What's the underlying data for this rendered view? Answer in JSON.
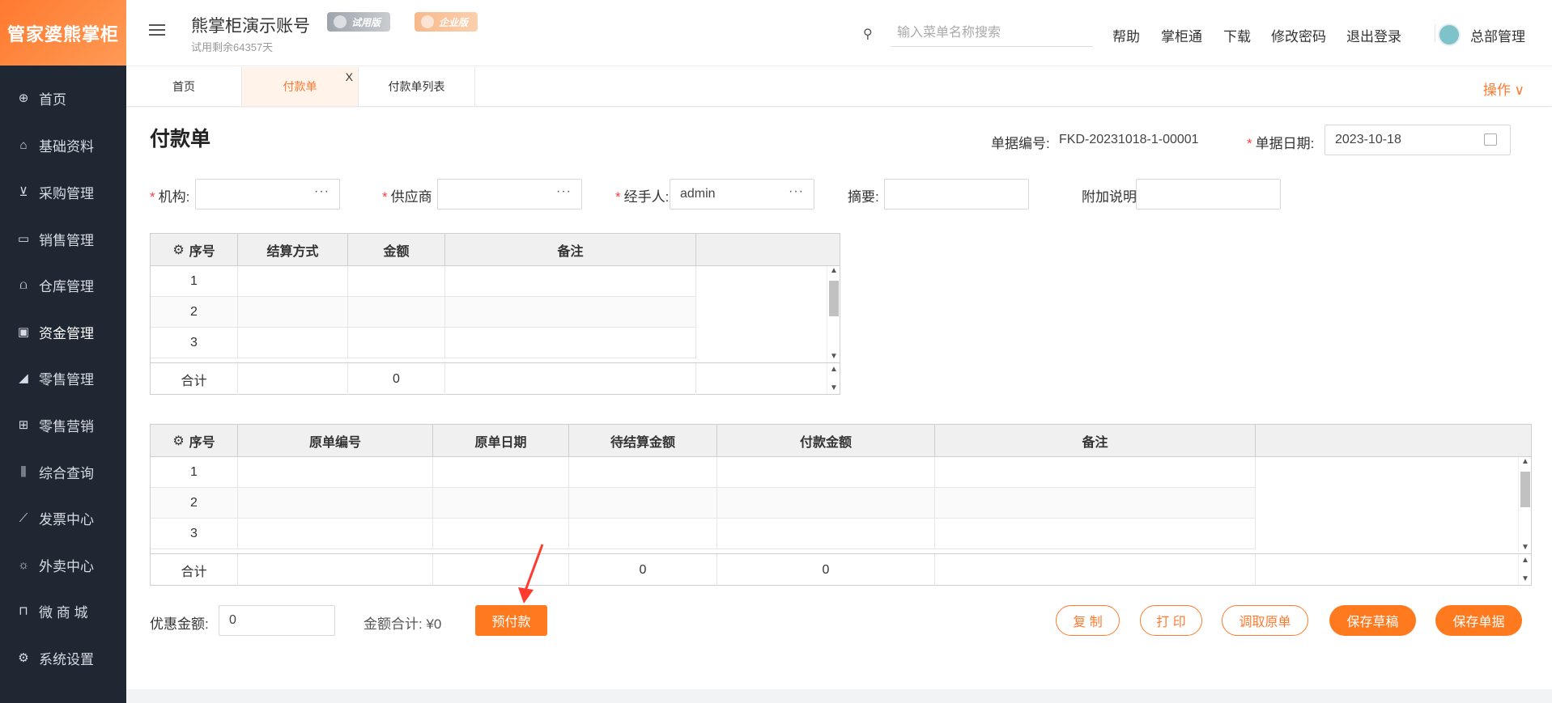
{
  "sidebar": {
    "logo": "管家婆熊掌柜",
    "items": [
      {
        "label": "首页",
        "icon": "globe-icon"
      },
      {
        "label": "基础资料",
        "icon": "home-icon"
      },
      {
        "label": "采购管理",
        "icon": "cart-icon"
      },
      {
        "label": "销售管理",
        "icon": "sales-icon"
      },
      {
        "label": "仓库管理",
        "icon": "warehouse-icon"
      },
      {
        "label": "资金管理",
        "icon": "finance-icon"
      },
      {
        "label": "零售管理",
        "icon": "chart-icon"
      },
      {
        "label": "零售营销",
        "icon": "gift-icon"
      },
      {
        "label": "综合查询",
        "icon": "bar-chart-icon"
      },
      {
        "label": "发票中心",
        "icon": "trend-icon"
      },
      {
        "label": "外卖中心",
        "icon": "alarm-icon"
      },
      {
        "label": "微 商 城",
        "icon": "bag-icon"
      },
      {
        "label": "系统设置",
        "icon": "gear-icon"
      }
    ]
  },
  "header": {
    "account_title": "熊掌柜演示账号",
    "trial_badge": "试用版",
    "enterprise_badge": "企业版",
    "trial_remaining": "试用剩余64357天",
    "search_placeholder": "输入菜单名称搜索",
    "links": [
      "帮助",
      "掌柜通",
      "下载",
      "修改密码",
      "退出登录"
    ],
    "user_name": "总部管理"
  },
  "tabs": {
    "items": [
      "首页",
      "付款单",
      "付款单列表"
    ],
    "close": "X",
    "ops_label": "操作 ∨"
  },
  "form": {
    "title": "付款单",
    "doc_no_label": "单据编号:",
    "doc_no": "FKD-20231018-1-00001",
    "doc_date_label": "单据日期:",
    "doc_date": "2023-10-18",
    "org_label": "机构:",
    "supplier_label": "供应商",
    "handler_label": "经手人:",
    "handler_value": "admin",
    "summary_label": "摘要:",
    "remark_label": "附加说明",
    "dots": "···"
  },
  "table1": {
    "headers": [
      "序号",
      "结算方式",
      "金额",
      "备注"
    ],
    "rows": [
      "1",
      "2",
      "3"
    ],
    "sum_label": "合计",
    "sum_amount": "0"
  },
  "table2": {
    "headers": [
      "序号",
      "原单编号",
      "原单日期",
      "待结算金额",
      "付款金额",
      "备注"
    ],
    "rows": [
      "1",
      "2",
      "3"
    ],
    "sum_label": "合计",
    "sum_pending": "0",
    "sum_pay": "0"
  },
  "footer": {
    "discount_label": "优惠金额:",
    "discount_value": "0",
    "total_label": "金额合计: ¥0",
    "prepay_btn": "预付款",
    "copy_btn": "复 制",
    "print_btn": "打 印",
    "fetch_btn": "调取原单",
    "save_draft_btn": "保存草稿",
    "save_btn": "保存单据"
  },
  "colors": {
    "accent": "#ff7a1f",
    "sidebar_bg": "#1f2733",
    "required": "#ff3b3b"
  }
}
